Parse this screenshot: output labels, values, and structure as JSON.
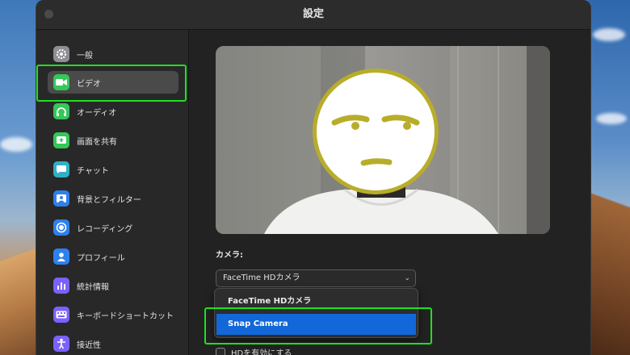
{
  "window": {
    "title": "設定"
  },
  "sidebar": {
    "items": [
      {
        "label": "一般",
        "icon": "gear-icon",
        "color": "#8e8e93"
      },
      {
        "label": "ビデオ",
        "icon": "video-camera-icon",
        "color": "#34c759"
      },
      {
        "label": "オーディオ",
        "icon": "headphones-icon",
        "color": "#34c759"
      },
      {
        "label": "画面を共有",
        "icon": "share-screen-icon",
        "color": "#34c759"
      },
      {
        "label": "チャット",
        "icon": "chat-bubble-icon",
        "color": "#30b0c7"
      },
      {
        "label": "背景とフィルター",
        "icon": "background-image-icon",
        "color": "#2f80ed"
      },
      {
        "label": "レコーディング",
        "icon": "record-icon",
        "color": "#2f80ed"
      },
      {
        "label": "プロフィール",
        "icon": "person-icon",
        "color": "#2f80ed"
      },
      {
        "label": "統計情報",
        "icon": "bar-chart-icon",
        "color": "#7b61ff"
      },
      {
        "label": "キーボードショートカット",
        "icon": "keyboard-icon",
        "color": "#7b61ff"
      },
      {
        "label": "接近性",
        "icon": "accessibility-icon",
        "color": "#7b61ff"
      }
    ],
    "active": "ビデオ"
  },
  "video": {
    "camera_label": "カメラ:",
    "camera_selected": "FaceTime HDカメラ",
    "camera_options": [
      "FaceTime HDカメラ",
      "Snap Camera"
    ],
    "highlighted_option": "Snap Camera",
    "hd_checkbox_label": "HDを有効にする",
    "hd_checked": false
  },
  "colors": {
    "highlight": "#1ee021",
    "accent": "#1268d9"
  }
}
